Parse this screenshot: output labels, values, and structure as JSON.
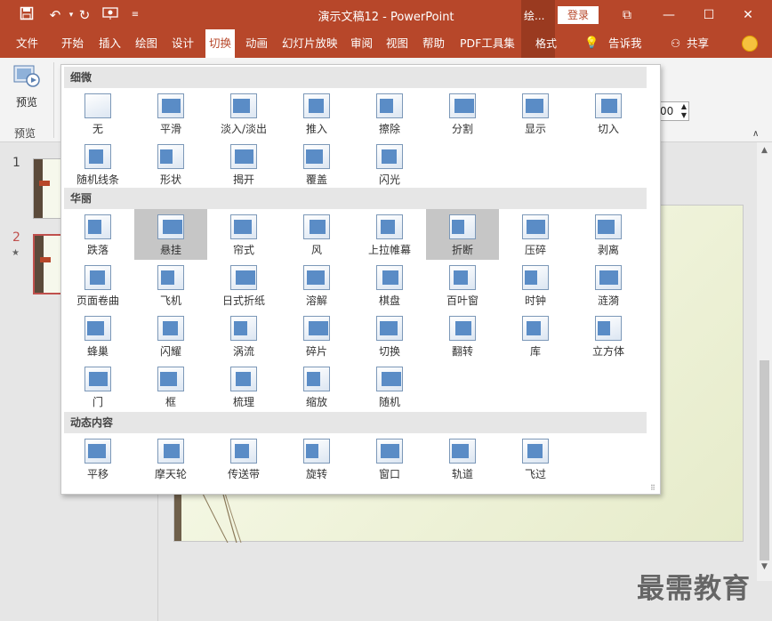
{
  "titlebar": {
    "title": "演示文稿12  -  PowerPoint",
    "draw_tab": "绘...",
    "login": "登录"
  },
  "menubar": {
    "items": [
      "文件",
      "开始",
      "插入",
      "绘图",
      "设计",
      "切换",
      "动画",
      "幻灯片放映",
      "审阅",
      "视图",
      "帮助",
      "PDF工具集"
    ],
    "active": "切换",
    "format_tab": "格式",
    "tell_me": "告诉我",
    "share": "共享"
  },
  "ribbon": {
    "preview_button": "预览",
    "preview_group": "预览",
    "duration_value": "00"
  },
  "thumbnails": [
    {
      "number": "1"
    },
    {
      "number": "2",
      "star": "★"
    }
  ],
  "gallery": {
    "sections": [
      {
        "title": "细微",
        "items": [
          "无",
          "平滑",
          "淡入/淡出",
          "推入",
          "擦除",
          "分割",
          "显示",
          "切入",
          "随机线条",
          "形状",
          "揭开",
          "覆盖",
          "闪光"
        ]
      },
      {
        "title": "华丽",
        "items": [
          "跌落",
          "悬挂",
          "帘式",
          "风",
          "上拉帷幕",
          "折断",
          "压碎",
          "剥离",
          "页面卷曲",
          "飞机",
          "日式折纸",
          "溶解",
          "棋盘",
          "百叶窗",
          "时钟",
          "涟漪",
          "蜂巢",
          "闪耀",
          "涡流",
          "碎片",
          "切换",
          "翻转",
          "库",
          "立方体",
          "门",
          "框",
          "梳理",
          "缩放",
          "随机"
        ]
      },
      {
        "title": "动态内容",
        "items": [
          "平移",
          "摩天轮",
          "传送带",
          "旋转",
          "窗口",
          "轨道",
          "飞过"
        ]
      }
    ],
    "selected": [
      "悬挂",
      "折断"
    ]
  },
  "watermark": "最需教育",
  "colors": {
    "accent": "#b7472a",
    "icon_blue": "#5a8cc6"
  }
}
